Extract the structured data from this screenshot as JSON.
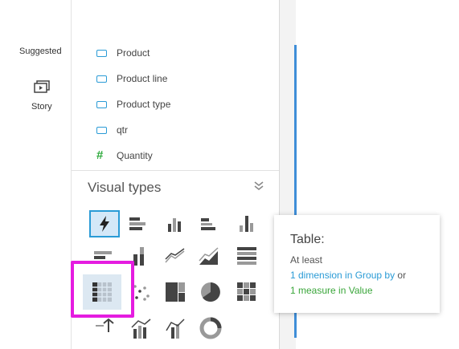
{
  "rail": {
    "suggested_label": "Suggested",
    "story_label": "Story"
  },
  "fields": [
    {
      "label": "Product",
      "kind": "dimension"
    },
    {
      "label": "Product line",
      "kind": "dimension"
    },
    {
      "label": "Product type",
      "kind": "dimension"
    },
    {
      "label": "qtr",
      "kind": "dimension"
    },
    {
      "label": "Quantity",
      "kind": "measure"
    }
  ],
  "visual_types": {
    "title": "Visual types",
    "selected": "autograph",
    "highlighted": "table"
  },
  "tooltip": {
    "title": "Table:",
    "line1": "At least",
    "dim_req": "1 dimension in Group by",
    "or_text": " or",
    "measure_req": "1 measure in Value"
  },
  "colors": {
    "accent": "#2a9bd6",
    "measure_green": "#2eaa3c",
    "highlight_magenta": "#e51ce0"
  }
}
